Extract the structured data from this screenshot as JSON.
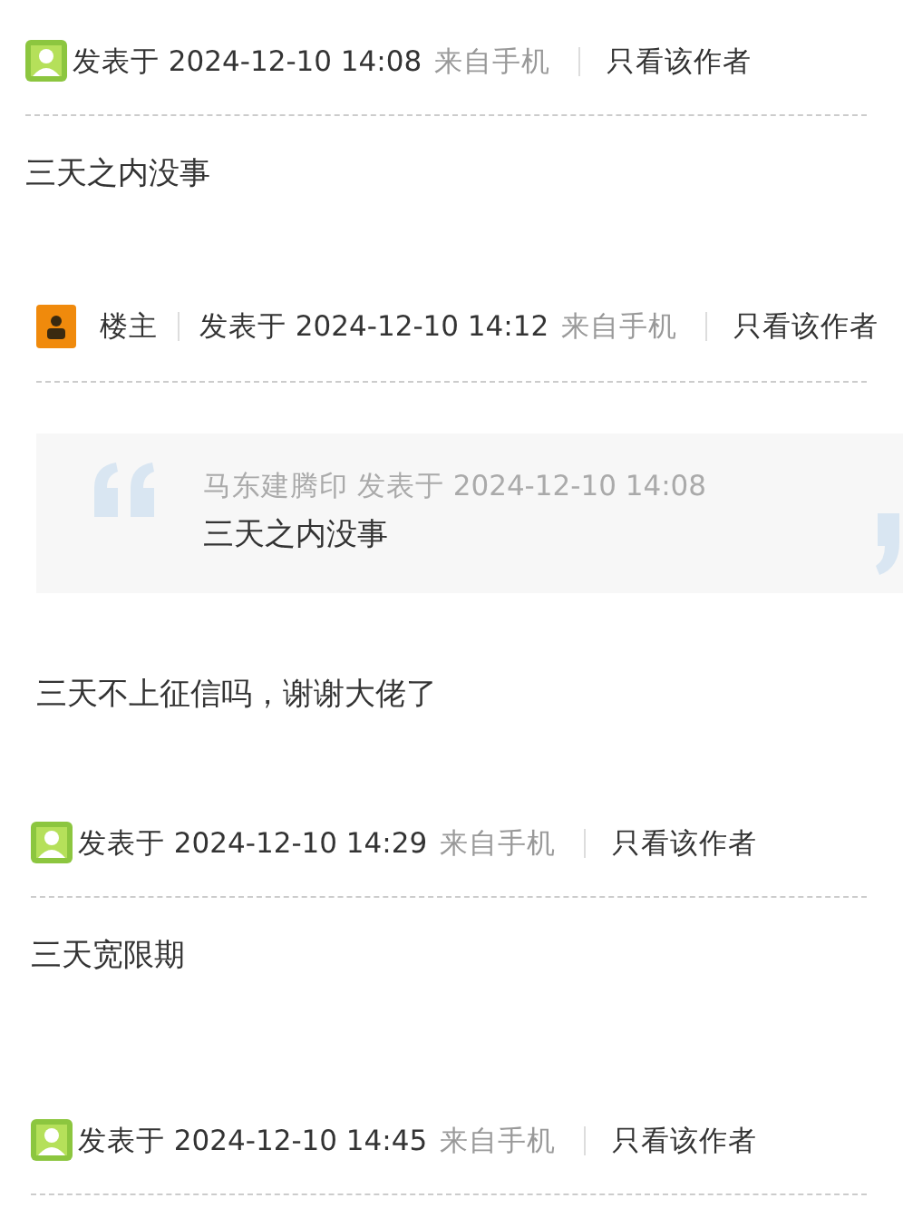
{
  "posts": [
    {
      "kind": "user",
      "posted": "发表于 2024-12-10 14:08",
      "source": "来自手机",
      "author_only": "只看该作者",
      "body": "三天之内没事"
    },
    {
      "kind": "op",
      "op_label": "楼主",
      "posted": "发表于 2024-12-10 14:12",
      "source": "来自手机",
      "author_only": "只看该作者",
      "quote": {
        "meta": "马东建腾印 发表于 2024-12-10 14:08",
        "text": "三天之内没事"
      },
      "body": "三天不上征信吗，谢谢大佬了"
    },
    {
      "kind": "user",
      "posted": "发表于 2024-12-10 14:29",
      "source": "来自手机",
      "author_only": "只看该作者",
      "body": "三天宽限期"
    },
    {
      "kind": "user",
      "posted": "发表于 2024-12-10 14:45",
      "source": "来自手机",
      "author_only": "只看该作者"
    }
  ]
}
